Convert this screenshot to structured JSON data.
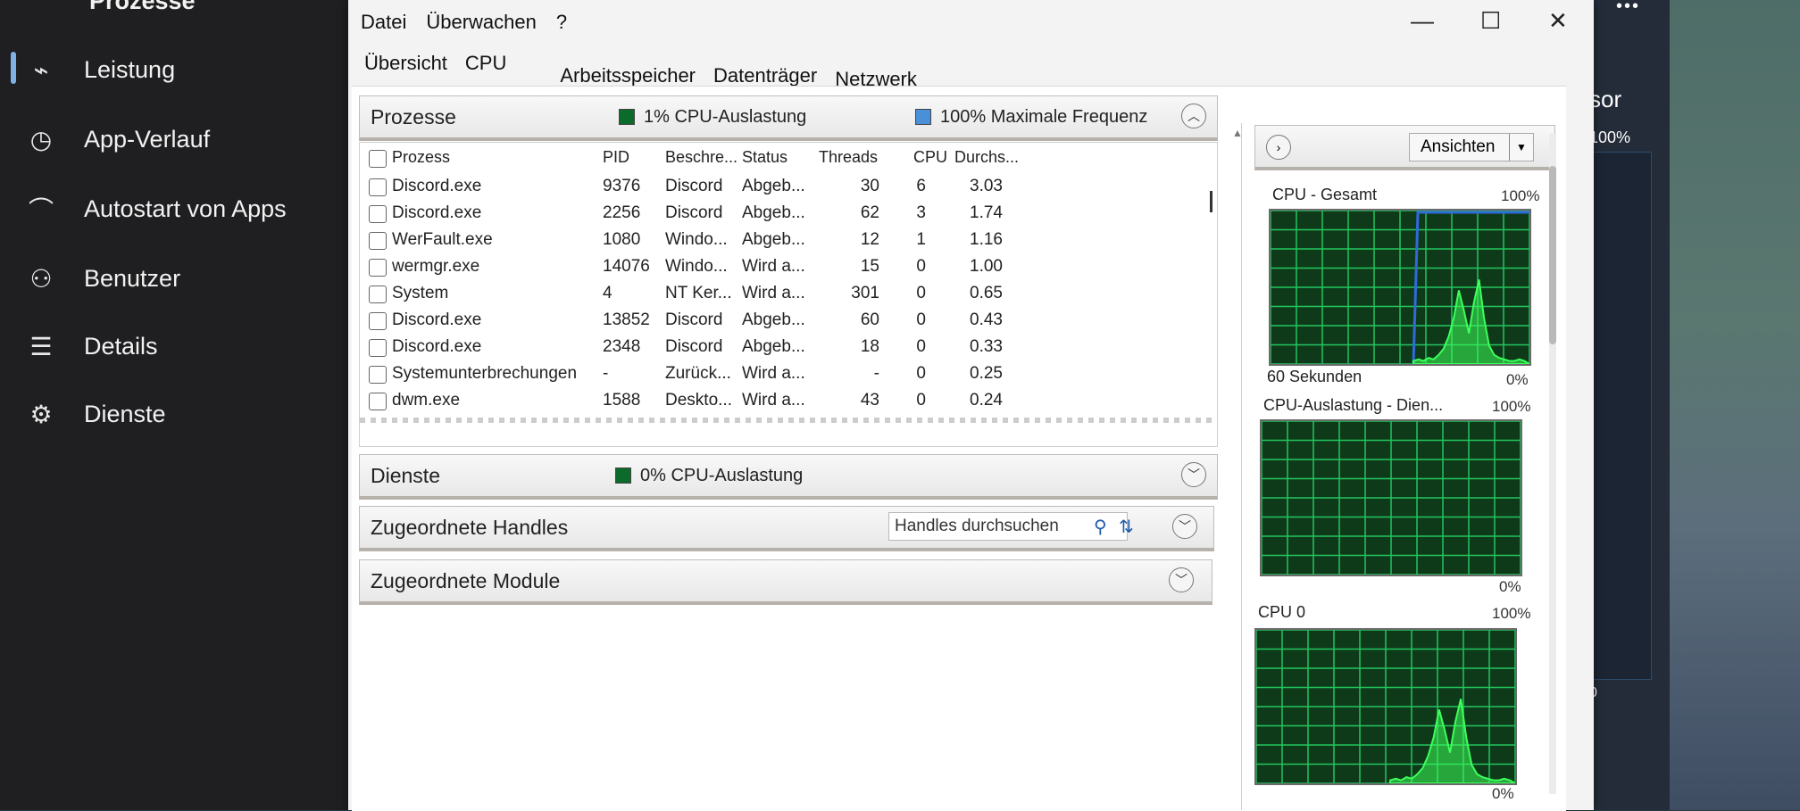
{
  "background_app": {
    "top_item": "Prozesse",
    "nav_items": [
      {
        "label": "Leistung",
        "icon": "performance-icon"
      },
      {
        "label": "App-Verlauf",
        "icon": "history-icon"
      },
      {
        "label": "Autostart von Apps",
        "icon": "startup-icon"
      },
      {
        "label": "Benutzer",
        "icon": "users-icon"
      },
      {
        "label": "Details",
        "icon": "details-icon"
      },
      {
        "label": "Dienste",
        "icon": "services-icon"
      }
    ],
    "right_panel": {
      "title_fragment": "sor",
      "top_pct": "100%",
      "bottom_value": "0",
      "more": "•••"
    }
  },
  "window": {
    "menu": [
      "Datei",
      "Überwachen",
      "?"
    ],
    "tabs": [
      "Übersicht",
      "CPU",
      "Arbeitsspeicher",
      "Datenträger",
      "Netzwerk"
    ],
    "selected_tab": "CPU",
    "controls": {
      "minimize": "—",
      "maximize": "☐",
      "close": "✕"
    }
  },
  "processes": {
    "title": "Prozesse",
    "cpu_usage": "1% CPU-Auslastung",
    "max_freq": "100% Maximale Frequenz",
    "columns": {
      "process": "Prozess",
      "pid": "PID",
      "desc": "Beschre...",
      "status": "Status",
      "threads": "Threads",
      "cpu": "CPU",
      "avg": "Durchs..."
    },
    "rows": [
      {
        "name": "Discord.exe",
        "pid": "9376",
        "desc": "Discord",
        "status": "Abgeb...",
        "threads": "30",
        "cpu": "6",
        "avg": "3.03"
      },
      {
        "name": "Discord.exe",
        "pid": "2256",
        "desc": "Discord",
        "status": "Abgeb...",
        "threads": "62",
        "cpu": "3",
        "avg": "1.74"
      },
      {
        "name": "WerFault.exe",
        "pid": "1080",
        "desc": "Windo...",
        "status": "Abgeb...",
        "threads": "12",
        "cpu": "1",
        "avg": "1.16"
      },
      {
        "name": "wermgr.exe",
        "pid": "14076",
        "desc": "Windo...",
        "status": "Wird a...",
        "threads": "15",
        "cpu": "0",
        "avg": "1.00"
      },
      {
        "name": "System",
        "pid": "4",
        "desc": "NT Ker...",
        "status": "Wird a...",
        "threads": "301",
        "cpu": "0",
        "avg": "0.65"
      },
      {
        "name": "Discord.exe",
        "pid": "13852",
        "desc": "Discord",
        "status": "Abgeb...",
        "threads": "60",
        "cpu": "0",
        "avg": "0.43"
      },
      {
        "name": "Discord.exe",
        "pid": "2348",
        "desc": "Discord",
        "status": "Abgeb...",
        "threads": "18",
        "cpu": "0",
        "avg": "0.33"
      },
      {
        "name": "Systemunterbrechungen",
        "pid": "-",
        "desc": "Zurück...",
        "status": "Wird a...",
        "threads": "-",
        "cpu": "0",
        "avg": "0.25"
      },
      {
        "name": "dwm.exe",
        "pid": "1588",
        "desc": "Deskto...",
        "status": "Wird a...",
        "threads": "43",
        "cpu": "0",
        "avg": "0.24"
      }
    ]
  },
  "services": {
    "title": "Dienste",
    "cpu_usage": "0% CPU-Auslastung"
  },
  "handles": {
    "title": "Zugeordnete Handles",
    "search_placeholder": "Handles durchsuchen"
  },
  "modules": {
    "title": "Zugeordnete Module"
  },
  "graphs": {
    "views_button": "Ansichten",
    "cpu_total": {
      "label": "CPU - Gesamt",
      "top": "100%",
      "bottom": "0%",
      "time": "60 Sekunden"
    },
    "cpu_services": {
      "label": "CPU-Auslastung - Dien...",
      "top": "100%",
      "bottom": "0%"
    },
    "cpu0": {
      "label": "CPU 0",
      "top": "100%",
      "bottom": "0%"
    }
  },
  "colors": {
    "cpu_swatch": "#0b6b2a",
    "freq_swatch": "#4a90d9",
    "graph_bg": "#0f3a1a",
    "graph_grid": "#22c55e",
    "graph_line": "#3dff5a",
    "freq_line": "#2f6bd8"
  }
}
